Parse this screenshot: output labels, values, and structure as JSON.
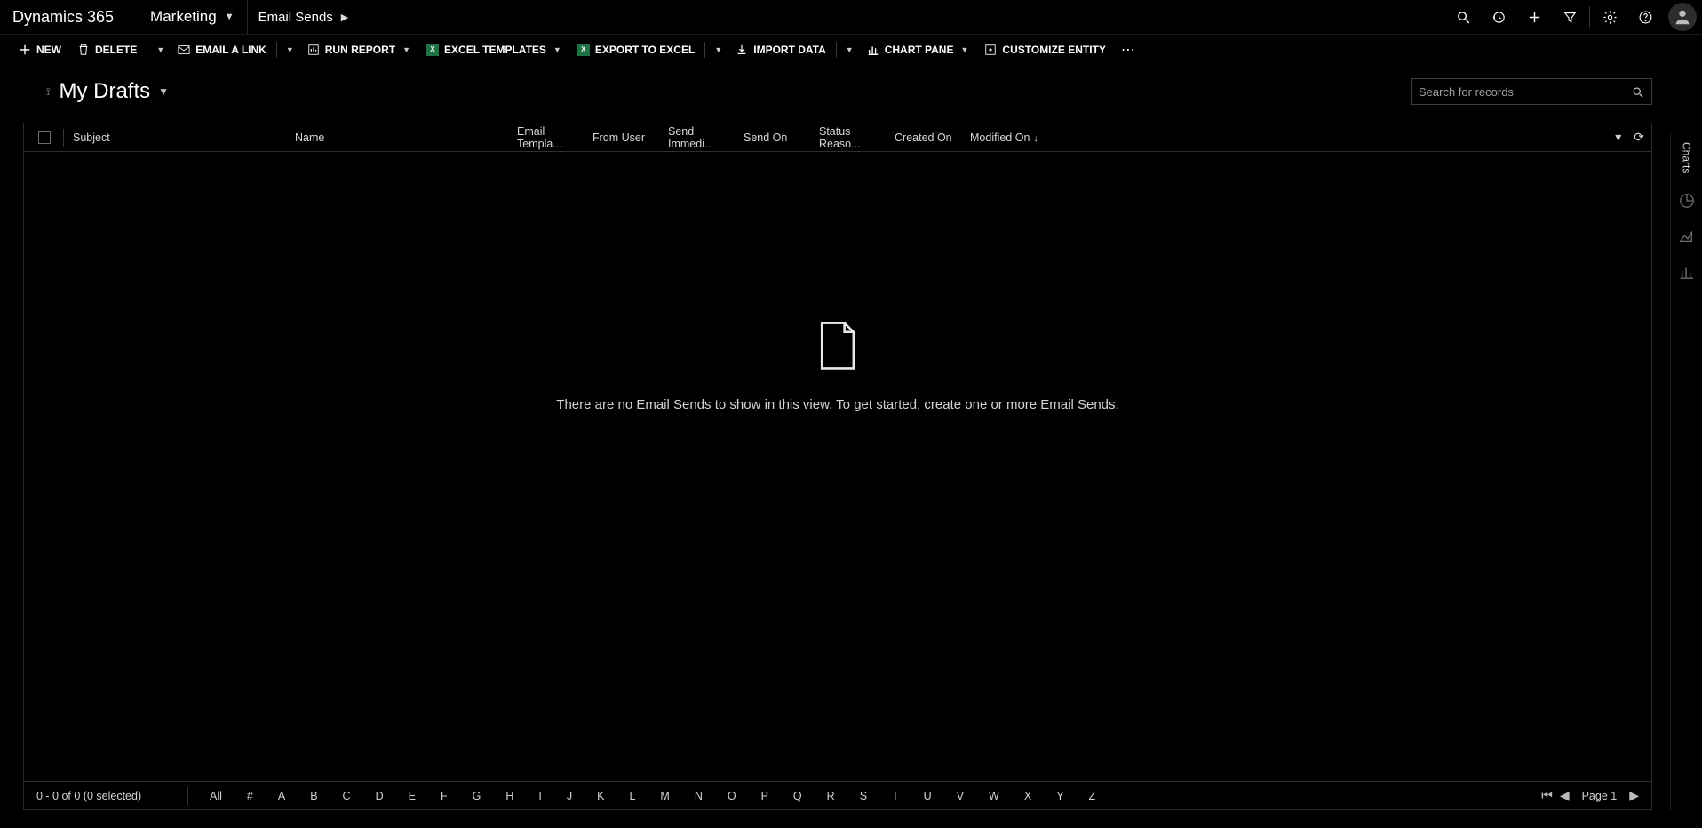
{
  "top": {
    "brand": "Dynamics 365",
    "area": "Marketing",
    "crumb": "Email Sends"
  },
  "cmd": {
    "new": "NEW",
    "delete": "DELETE",
    "email": "EMAIL A LINK",
    "report": "RUN REPORT",
    "excel_tpl": "EXCEL TEMPLATES",
    "export": "EXPORT TO EXCEL",
    "import": "IMPORT DATA",
    "chart": "CHART PANE",
    "custom": "CUSTOMIZE ENTITY"
  },
  "view": {
    "name": "My Drafts",
    "search_ph": "Search for records"
  },
  "cols": {
    "subject": "Subject",
    "name": "Name",
    "tpl": "Email Templa...",
    "from": "From User",
    "sendimm": "Send Immedi...",
    "sendon": "Send On",
    "status": "Status Reaso...",
    "created": "Created On",
    "modified": "Modified On"
  },
  "empty_msg": "There are no Email Sends to show in this view. To get started, create one or more Email Sends.",
  "foot": {
    "count": "0 - 0 of 0 (0 selected)",
    "page": "Page 1"
  },
  "alpha": [
    "All",
    "#",
    "A",
    "B",
    "C",
    "D",
    "E",
    "F",
    "G",
    "H",
    "I",
    "J",
    "K",
    "L",
    "M",
    "N",
    "O",
    "P",
    "Q",
    "R",
    "S",
    "T",
    "U",
    "V",
    "W",
    "X",
    "Y",
    "Z"
  ],
  "rail_label": "Charts"
}
